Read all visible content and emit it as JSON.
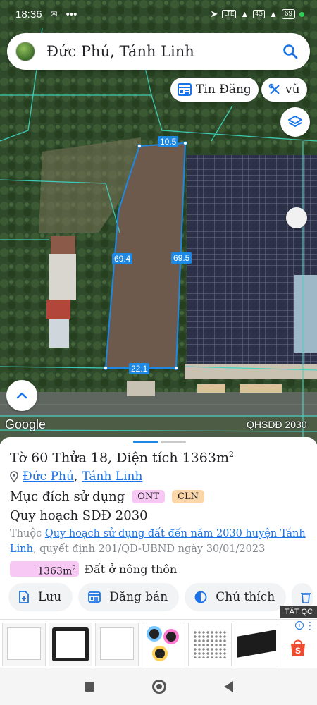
{
  "status_bar": {
    "time": "18:36",
    "network_1": "LTE",
    "network_2": "4G",
    "battery": "69"
  },
  "search": {
    "query": "Đức Phú, Tánh Linh"
  },
  "map_chips": {
    "news_label": "Tin Đăng",
    "user_label": "vũ"
  },
  "map": {
    "provider": "Google",
    "layer_label": "QHSDĐ 2030",
    "dimensions": {
      "top": "10.5",
      "left": "69.4",
      "right": "69.5",
      "bottom": "22.1"
    }
  },
  "parcel": {
    "title": "Tờ 60 Thửa 18, Diện tích 1363m",
    "title_sup": "2",
    "commune": "Đức Phú",
    "separator": ",",
    "district": "Tánh Linh",
    "purpose_label": "Mục đích sử dụng",
    "purpose_codes": [
      "ONT",
      "CLN"
    ],
    "plan_title": "Quy hoạch SDĐ 2030",
    "plan_prefix": "Thuộc",
    "plan_link": "Quy hoạch sử dụng đất đến năm 2030 huyện Tánh Linh",
    "plan_suffix": ", quyết định 201/QĐ-UBND ngày 30/01/2023",
    "area_value": "1363m",
    "area_sup": "2",
    "area_label": "Đất ở nông thôn"
  },
  "actions": {
    "save": "Lưu",
    "post_sale": "Đăng bán",
    "note": "Chú thích"
  },
  "ad": {
    "close_label": "TẮT QC",
    "info": "i"
  },
  "colors": {
    "accent": "#1a73e8",
    "parcel_outline": "#1e88e5",
    "ont_badge": "#f8c8f5",
    "cln_badge": "#fbd6a8"
  }
}
